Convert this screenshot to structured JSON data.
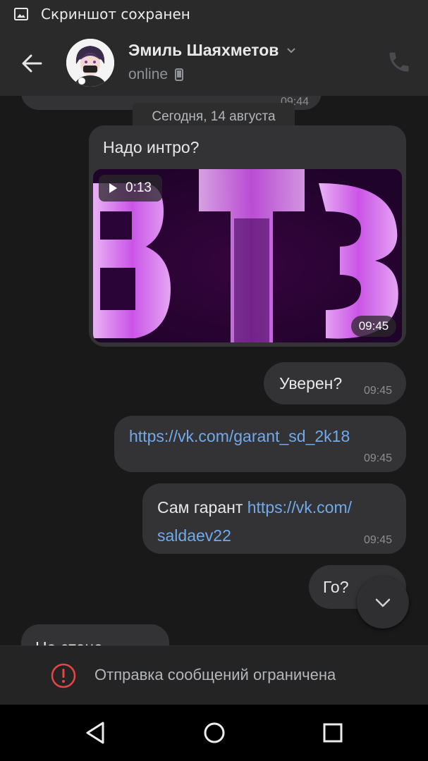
{
  "status_bar": {
    "notification": "Скриншот сохранен",
    "icon": "image-icon"
  },
  "header": {
    "contact_name": "Эмиль Шаяхметов",
    "status": "online",
    "icons": [
      "back-arrow-icon",
      "chevron-down-icon",
      "mobile-phone-icon",
      "phone-icon"
    ]
  },
  "messages": {
    "partial_top_time": "09:44",
    "date_separator": "Сегодня, 14 августа",
    "video_message": {
      "text": "Надо интро?",
      "duration": "0:13",
      "time": "09:45"
    },
    "msg_sure": {
      "text": "Уверен?",
      "time": "09:45"
    },
    "msg_link": {
      "link": "https://vk.com/garant_sd_2k18",
      "time": "09:45"
    },
    "msg_garant": {
      "text": "Сам гарант ",
      "link_line1": "https://vk.com/",
      "link_line2": "saldaev22",
      "time": "09:45"
    },
    "msg_go": {
      "text": "Го?"
    },
    "partial_bottom_text": "На стене"
  },
  "footer": {
    "restriction_text": "Отправка сообщений ограничена",
    "icon": "warning-icon"
  },
  "navbar": {
    "icons": [
      "back-triangle-icon",
      "home-circle-icon",
      "recents-square-icon"
    ]
  },
  "colors": {
    "link": "#71aaeb",
    "bubble": "#333335",
    "warning": "#e64646"
  }
}
